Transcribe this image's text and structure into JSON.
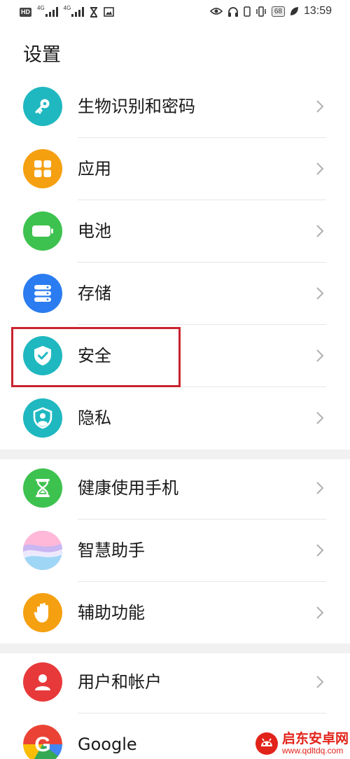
{
  "status_bar": {
    "hd_label": "HD",
    "signal_tag_1": "4G",
    "signal_tag_2": "4G",
    "battery_level": "68",
    "time": "13:59"
  },
  "page": {
    "title": "设置"
  },
  "groups": [
    {
      "items": [
        {
          "label": "生物识别和密码",
          "icon": "key-icon",
          "color": "#1fb8c0"
        },
        {
          "label": "应用",
          "icon": "apps-grid-icon",
          "color": "#f5a011"
        },
        {
          "label": "电池",
          "icon": "battery-icon",
          "color": "#3ec24f"
        },
        {
          "label": "存储",
          "icon": "storage-icon",
          "color": "#2a7cf0"
        },
        {
          "label": "安全",
          "icon": "shield-check-icon",
          "color": "#1fb8c0",
          "highlighted": true
        },
        {
          "label": "隐私",
          "icon": "privacy-shield-icon",
          "color": "#1fb8c0"
        }
      ]
    },
    {
      "items": [
        {
          "label": "健康使用手机",
          "icon": "hourglass-icon",
          "color": "#3ec24f"
        },
        {
          "label": "智慧助手",
          "icon": "assistant-icon",
          "color": "#b9a0e8"
        },
        {
          "label": "辅助功能",
          "icon": "hand-icon",
          "color": "#f5a011"
        }
      ]
    },
    {
      "items": [
        {
          "label": "用户和帐户",
          "icon": "user-icon",
          "color": "#e8393a"
        },
        {
          "label": "Google",
          "icon": "google-icon",
          "color": "#ffffff"
        }
      ]
    }
  ],
  "highlight_color": "#c8242e",
  "watermark": {
    "title": "启东安卓网",
    "url": "www.qdltdq.com",
    "color": "#e2231a"
  }
}
